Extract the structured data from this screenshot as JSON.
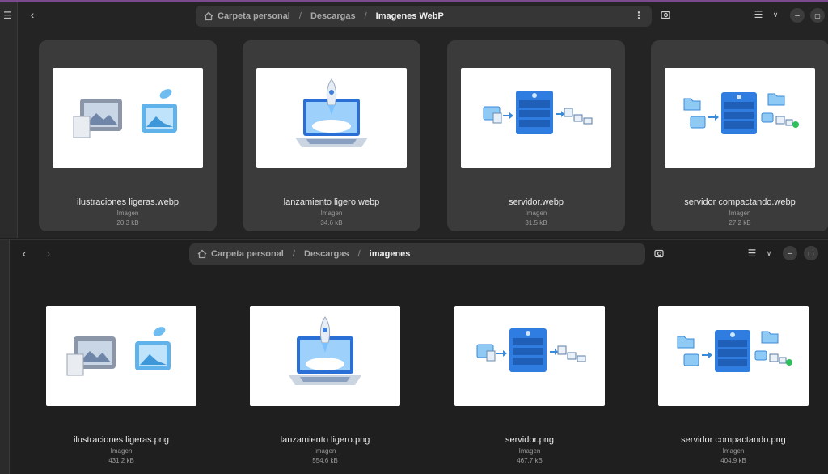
{
  "windows": [
    {
      "path": [
        "Carpeta personal",
        "Descargas",
        "Imagenes WebP"
      ],
      "items": [
        {
          "name": "ilustraciones ligeras.webp",
          "type": "Imagen",
          "size": "20.3 kB",
          "thumb": "illustrations"
        },
        {
          "name": "lanzamiento ligero.webp",
          "type": "Imagen",
          "size": "34.6 kB",
          "thumb": "rocket-laptop"
        },
        {
          "name": "servidor.webp",
          "type": "Imagen",
          "size": "31.5 kB",
          "thumb": "server"
        },
        {
          "name": "servidor compactando.webp",
          "type": "Imagen",
          "size": "27.2 kB",
          "thumb": "server-compacting"
        }
      ]
    },
    {
      "path": [
        "Carpeta personal",
        "Descargas",
        "imagenes"
      ],
      "items": [
        {
          "name": "ilustraciones ligeras.png",
          "type": "Imagen",
          "size": "431.2 kB",
          "thumb": "illustrations"
        },
        {
          "name": "lanzamiento ligero.png",
          "type": "Imagen",
          "size": "554.6 kB",
          "thumb": "rocket-laptop"
        },
        {
          "name": "servidor.png",
          "type": "Imagen",
          "size": "467.7 kB",
          "thumb": "server"
        },
        {
          "name": "servidor compactando.png",
          "type": "Imagen",
          "size": "404.9 kB",
          "thumb": "server-compacting"
        }
      ]
    }
  ],
  "icons": {
    "back": "chevron-left-icon",
    "forward": "chevron-right-icon",
    "home": "home-icon",
    "menu": "kebab-menu-icon",
    "search": "search-icon",
    "view": "list-view-icon",
    "view_options": "chevron-down-icon",
    "minimize": "minimize-icon",
    "maximize": "maximize-icon"
  },
  "colors": {
    "accent_border": "#7b4b8e",
    "selection": "#3b3b3b",
    "thumbnail_blue": "#2f7de1"
  }
}
